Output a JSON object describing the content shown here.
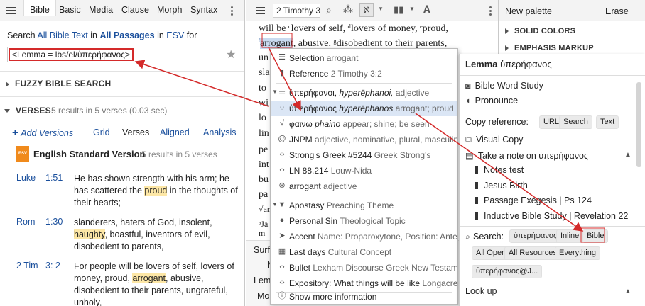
{
  "left": {
    "tabs": [
      "Bible",
      "Basic",
      "Media",
      "Clause",
      "Morph",
      "Syntax"
    ],
    "search_prefix": "Search",
    "search_all_bible_text": "All Bible Text",
    "search_in": "in",
    "search_all_passages": "All Passages",
    "search_in2": "in",
    "search_version": "ESV",
    "search_for": "for",
    "query": "<Lemma = lbs/el/ὑπερήφανος>",
    "fuzzy_header": "FUZZY BIBLE SEARCH",
    "verses_header": "VERSES",
    "verses_count": "5 results in 5 verses (0.03 sec)",
    "add_versions": "Add Versions",
    "view_grid": "Grid",
    "view_verses": "Verses",
    "view_aligned": "Aligned",
    "view_analysis": "Analysis",
    "version_badge": "ESV",
    "version_name": "English Standard Version",
    "version_count": "5 results in 5 verses",
    "results": [
      {
        "book": "Luke",
        "ref": "1:51",
        "pre": "He has shown strength with his arm; he has scattered the ",
        "hl": "proud",
        "post": " in the thoughts of their hearts;"
      },
      {
        "book": "Rom",
        "ref": "1:30",
        "pre": "slanderers, haters of God, insolent, ",
        "hl": "haughty",
        "post": ", boastful, inventors of evil, disobedient to parents,"
      },
      {
        "book": "2 Tim",
        "ref": "3:  2",
        "pre": "For people will be lovers of self, lovers of money, proud, ",
        "hl": "arrogant",
        "post": ", abusive, disobedient to their parents, ungrateful, unholy,"
      }
    ]
  },
  "middle": {
    "ref_box": "2 Timothy 3",
    "line1": "will be ᶜlovers of self, ᵈlovers of money, ᵉproud,",
    "line2_hl": "arrogant",
    "line2_rest": ", abusive, ᵍdisobedient to their parents,",
    "frag_un": "un",
    "frag_sla": "sla",
    "frag_to": "to",
    "frag_wi": "wi",
    "frag_lo": "lo",
    "frag_lin": "lin",
    "frag_pe": "pe",
    "frag_int": "int",
    "frag_bu": "bu",
    "frag_pa": "pa",
    "frag_an": "√an",
    "frag_ja": "ᵃJa",
    "frag_m": "m",
    "surf": "Surf",
    "lem": "Lem",
    "mo": "Mo",
    "n": "N"
  },
  "popup": {
    "selection": "Selection",
    "selection_val": "arrogant",
    "reference": "Reference",
    "reference_val": "2 Timothy 3:2",
    "grp_word": "ὑπερήφανοι,",
    "grp_translit": "hyperēphanoi,",
    "grp_pos": "adjective",
    "lemma_word": "ὑπερήφανος",
    "lemma_translit": "hyperēphanos",
    "lemma_rest": "arrogant; proud",
    "root_word": "φαινω",
    "root_translit": "phaino",
    "root_rest": "appear; shine; be seen",
    "jnpm": "JNPM",
    "jnpm_rest": "adjective, nominative, plural, masculine",
    "strongs": "Strong's Greek #5244",
    "strongs_rest": "Greek Strong's",
    "ln": "LN 88.214",
    "ln_rest": "Louw-Nida",
    "sense": "arrogant",
    "sense_rest": "adjective",
    "theme1": "Apostasy",
    "theme1_type": "Preaching Theme",
    "theme2": "Personal Sin",
    "theme2_type": "Theological Topic",
    "accent": "Accent",
    "accent_rest": "Name: Proparoxytone, Position: Antepenult",
    "cultural": "Last days",
    "cultural_type": "Cultural Concept",
    "bullet": "Bullet",
    "bullet_rest": "Lexham Discourse Greek New Testament",
    "expo": "Expository: What things will be like",
    "expo_rest": "Longacre",
    "more": "Show more information"
  },
  "right": {
    "title": "New palette",
    "erase": "Erase",
    "solid": "SOLID COLORS",
    "emphasis": "EMPHASIS MARKUP"
  },
  "info": {
    "lemma_label": "Lemma",
    "lemma_word": "ὑπερήφανος",
    "bws": "Bible Word Study",
    "pronounce": "Pronounce",
    "copy_ref": "Copy reference:",
    "btn_url": "URL",
    "btn_search": "Search",
    "btn_text": "Text",
    "visual_copy": "Visual Copy",
    "take_note": "Take a note on ὑπερήφανος",
    "notes": [
      "Notes test",
      "Jesus Birth",
      "Passage Exegesis | Ps 124",
      "Inductive Bible Study | Revelation 22"
    ],
    "search_label": "Search:",
    "search_btns": [
      "ὑπερήφανος",
      "Inline",
      "Bible",
      "All Open",
      "All Resources",
      "Everything",
      "ὑπερήφανος@J..."
    ],
    "lookup": "Look up"
  },
  "colors": {
    "accent": "#1a4f9c",
    "highlight": "#fde7a6",
    "arrow": "#d42a2a"
  }
}
